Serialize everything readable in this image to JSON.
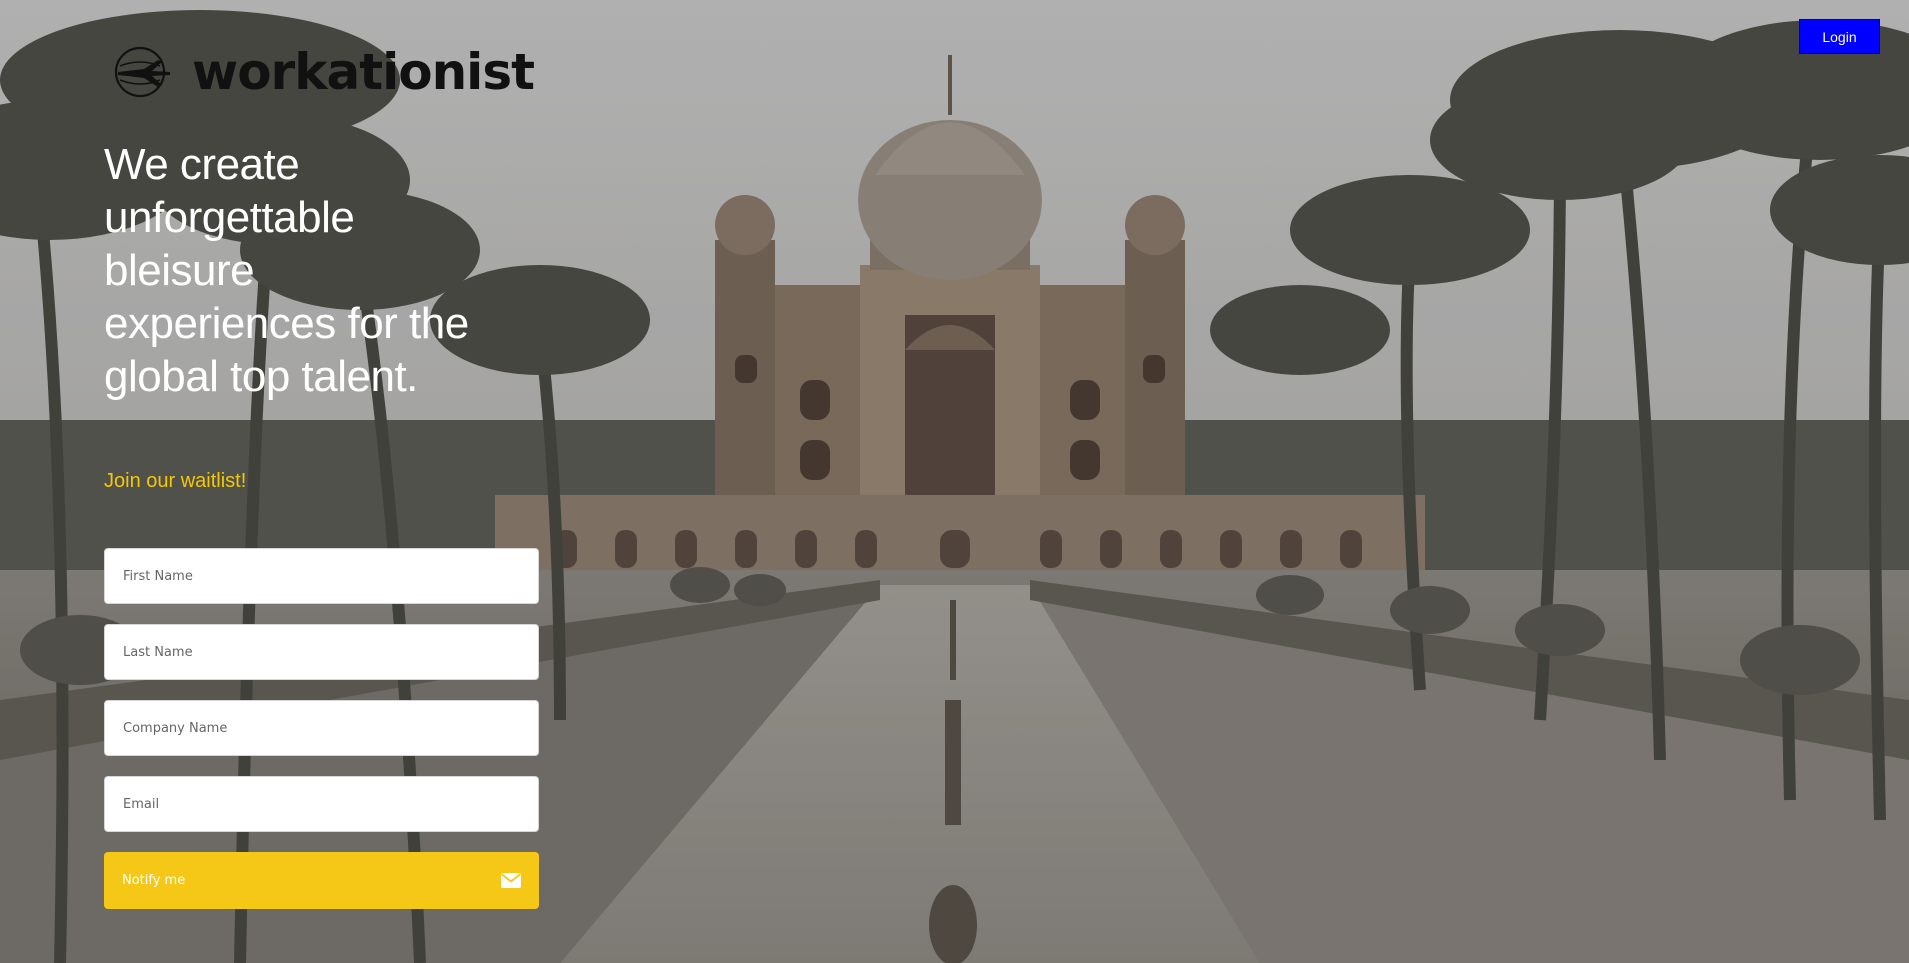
{
  "brand": {
    "name": "workationist",
    "icon": "airplane-globe-icon"
  },
  "header": {
    "login_label": "Login"
  },
  "hero": {
    "headline": "We create unforgettable bleisure experiences for the global top talent.",
    "waitlist": "Join our waitlist!"
  },
  "form": {
    "first_name_placeholder": "First Name",
    "last_name_placeholder": "Last Name",
    "company_placeholder": "Company Name",
    "email_placeholder": "Email",
    "submit_label": "Notify me",
    "submit_icon": "envelope-icon"
  },
  "colors": {
    "login_bg": "#0000ff",
    "accent_yellow": "#f5c818",
    "waitlist_text": "#f3c800"
  }
}
